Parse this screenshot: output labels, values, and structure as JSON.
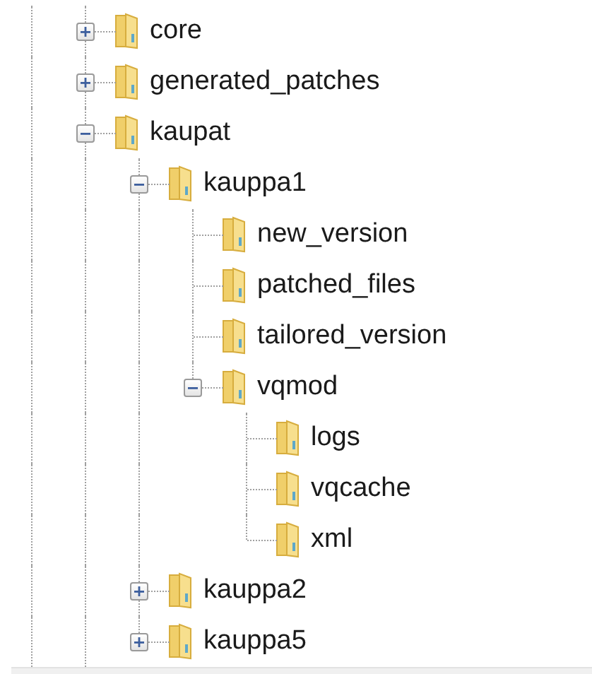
{
  "tree": [
    {
      "label": "core",
      "expanded": false
    },
    {
      "label": "generated_patches",
      "expanded": false
    },
    {
      "label": "kaupat",
      "expanded": true,
      "children": [
        {
          "label": "kauppa1",
          "expanded": true,
          "children": [
            {
              "label": "new_version"
            },
            {
              "label": "patched_files"
            },
            {
              "label": "tailored_version"
            },
            {
              "label": "vqmod",
              "expanded": true,
              "children": [
                {
                  "label": "logs"
                },
                {
                  "label": "vqcache"
                },
                {
                  "label": "xml"
                }
              ]
            }
          ]
        },
        {
          "label": "kauppa2",
          "expanded": false
        },
        {
          "label": "kauppa5",
          "expanded": false
        }
      ]
    }
  ]
}
